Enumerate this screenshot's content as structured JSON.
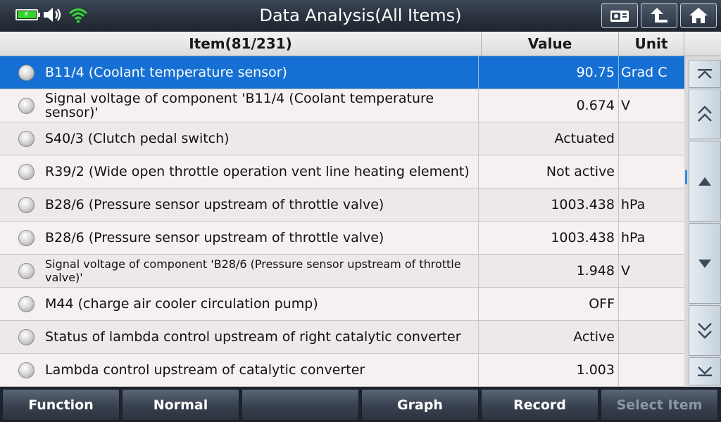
{
  "window": {
    "title": "Data Analysis(All Items)"
  },
  "table": {
    "headers": {
      "item": "Item(81/231)",
      "value": "Value",
      "unit": "Unit"
    },
    "rows": [
      {
        "item": "B11/4 (Coolant temperature sensor)",
        "value": "90.75",
        "unit": "Grad C",
        "selected": true
      },
      {
        "item": "Signal voltage of component 'B11/4 (Coolant temperature sensor)'",
        "value": "0.674",
        "unit": "V"
      },
      {
        "item": "S40/3 (Clutch pedal switch)",
        "value": "Actuated",
        "unit": ""
      },
      {
        "item": "R39/2 (Wide open throttle operation vent line heating element)",
        "value": "Not active",
        "unit": ""
      },
      {
        "item": "B28/6 (Pressure sensor upstream of throttle valve)",
        "value": "1003.438",
        "unit": "hPa"
      },
      {
        "item": "B28/6 (Pressure sensor upstream of throttle valve)",
        "value": "1003.438",
        "unit": "hPa"
      },
      {
        "item": "Signal voltage of component 'B28/6 (Pressure sensor upstream of throttle valve)'",
        "value": "1.948",
        "unit": "V"
      },
      {
        "item": "M44 (charge air cooler circulation pump)",
        "value": "OFF",
        "unit": ""
      },
      {
        "item": "Status of lambda control upstream of right catalytic converter",
        "value": "Active",
        "unit": ""
      },
      {
        "item": "Lambda control upstream of catalytic converter",
        "value": "1.003",
        "unit": ""
      }
    ]
  },
  "toolbar": {
    "function": "Function",
    "normal": "Normal",
    "empty": "",
    "graph": "Graph",
    "record": "Record",
    "select_item": "Select Item"
  },
  "icons": {
    "battery": "battery-charging-icon",
    "volume": "speaker-icon",
    "wifi": "wifi-icon",
    "screenshot": "camera-icon",
    "back": "back-arrow-icon",
    "home": "home-icon"
  },
  "colors": {
    "selected_row": "#1670d4",
    "battery_fill": "#34d42c",
    "wifi": "#3bd33b",
    "scroll_indicator": "#2b8be6"
  }
}
